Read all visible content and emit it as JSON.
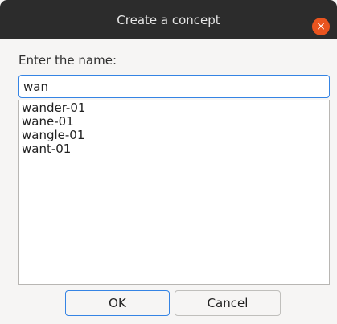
{
  "dialog": {
    "title": "Create a concept",
    "close_glyph": "×",
    "label": "Enter the name:",
    "input_value": "wan",
    "suggestions": [
      "wander-01",
      "wane-01",
      "wangle-01",
      "want-01"
    ],
    "ok_label": "OK",
    "cancel_label": "Cancel"
  },
  "colors": {
    "titlebar": "#2c2c2c",
    "close_button": "#e9541f",
    "focus_border": "#3584e4",
    "dialog_background": "#f6f5f4"
  },
  "icons": {
    "close": "close-icon"
  }
}
